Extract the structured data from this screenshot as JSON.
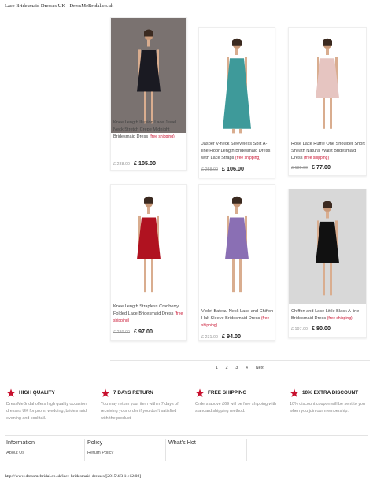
{
  "page": {
    "print_title": "Lace Bridesmaid Dresses UK - DressMeBridal.co.uk",
    "print_footer": "http://www.dressmebridal.co.uk/lace-bridesmaid-dresses/[2015/4/3 11:12:08]"
  },
  "products": [
    {
      "name": "Knee Length Illusion Lace Jewel Neck Stretch Crepe Midnight Bridesmaid Dress",
      "free": "(free shipping)",
      "old_price": "£ 238.00",
      "price": "£ 105.00",
      "dress_color": "#1a1a22",
      "bg": "#7a7270"
    },
    {
      "name": "Jasper V-neck Sleeveless Split A-line Floor Length Bridesmaid Dress with Lace Straps",
      "free": "(free shipping)",
      "old_price": "£ 258.00",
      "price": "£ 106.00",
      "dress_color": "#3e9a9a",
      "bg": "#ffffff"
    },
    {
      "name": "Rose Lace Ruffle One Shoulder Short Sheath Natural Waist Bridesmaid Dress",
      "free": "(free shipping)",
      "old_price": "£ 185.00",
      "price": "£ 77.00",
      "dress_color": "#e6c5c1",
      "bg": "#ffffff"
    },
    {
      "name": "Knee Length Strapless Cranberry Folded Lace Bridesmaid Dress",
      "free": "(free shipping)",
      "old_price": "£ 239.00",
      "price": "£ 97.00",
      "dress_color": "#b01220",
      "bg": "#ffffff"
    },
    {
      "name": "Violet Bateau Neck Lace and Chiffon Half Sleeve Bridesmaid Dress",
      "free": "(free shipping)",
      "old_price": "£ 231.00",
      "price": "£ 94.00",
      "dress_color": "#8a6fb4",
      "bg": "#ffffff"
    },
    {
      "name": "Chiffon and Lace Little Black A-line Bridesmaid Dress",
      "free": "(free shipping)",
      "old_price": "£ 197.00",
      "price": "£ 80.00",
      "dress_color": "#111111",
      "bg": "#d8d8d8"
    }
  ],
  "pagination": [
    "1",
    "2",
    "3",
    "4",
    "Next"
  ],
  "features": [
    {
      "icon": "star-icon",
      "title": "HIGH QUALITY",
      "desc": "DressMeBridal offers high quality occasion dresses UK for prom, wedding, bridesmaid, evening and cocktail."
    },
    {
      "icon": "star-icon",
      "title": "7 DAYS RETURN",
      "desc": "You may return your item within 7 days of receiving your order if you don't satisfied with the product."
    },
    {
      "icon": "star-icon",
      "title": "FREE SHIPPING",
      "desc": "Orders above £69 will be free shipping with standard shipping method."
    },
    {
      "icon": "star-icon",
      "title": "10% EXTRA DISCOUNT",
      "desc": "10% discount coupon will be sent to you when you join our membership."
    }
  ],
  "footer_cols": [
    {
      "heading": "Information",
      "link": "About Us"
    },
    {
      "heading": "Policy",
      "link": "Return Policy"
    },
    {
      "heading": "What's Hot",
      "link": ""
    }
  ],
  "accent": "#c8102e"
}
